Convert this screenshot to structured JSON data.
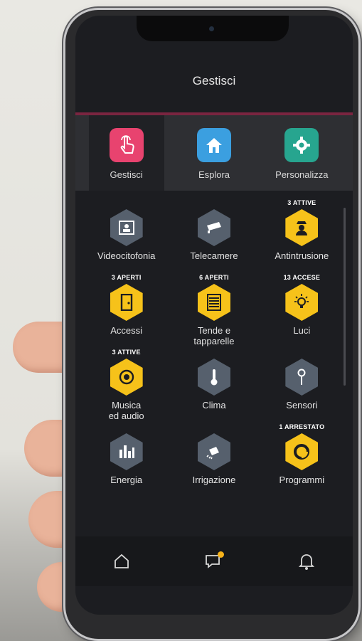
{
  "header": {
    "title": "Gestisci"
  },
  "tabs": [
    {
      "label": "Gestisci",
      "icon": "touch-hand-icon",
      "color": "#e8436f",
      "active": true
    },
    {
      "label": "Esplora",
      "icon": "home-icon",
      "color": "#3b9fe0",
      "active": false
    },
    {
      "label": "Personalizza",
      "icon": "gear-icon",
      "color": "#27a58f",
      "active": false
    }
  ],
  "grid": [
    {
      "label": "Videocitofonia",
      "badge": "",
      "icon": "video-intercom-icon",
      "style": "gray"
    },
    {
      "label": "Telecamere",
      "badge": "",
      "icon": "camera-icon",
      "style": "gray"
    },
    {
      "label": "Antintrusione",
      "badge": "3 ATTIVE",
      "icon": "guard-icon",
      "style": "yellow"
    },
    {
      "label": "Accessi",
      "badge": "3 APERTI",
      "icon": "door-icon",
      "style": "yellow"
    },
    {
      "label": "Tende e\ntapparelle",
      "badge": "6 APERTI",
      "icon": "shutter-icon",
      "style": "yellow"
    },
    {
      "label": "Luci",
      "badge": "13 ACCESE",
      "icon": "bulb-icon",
      "style": "yellow"
    },
    {
      "label": "Musica\ned audio",
      "badge": "3 ATTIVE",
      "icon": "speaker-icon",
      "style": "yellow"
    },
    {
      "label": "Clima",
      "badge": "",
      "icon": "thermometer-icon",
      "style": "gray"
    },
    {
      "label": "Sensori",
      "badge": "",
      "icon": "sensor-icon",
      "style": "gray"
    },
    {
      "label": "Energia",
      "badge": "",
      "icon": "energy-bars-icon",
      "style": "gray"
    },
    {
      "label": "Irrigazione",
      "badge": "",
      "icon": "watering-icon",
      "style": "gray"
    },
    {
      "label": "Programmi",
      "badge": "1 ARRESTATO",
      "icon": "program-icon",
      "style": "yellow"
    }
  ],
  "bottom_nav": [
    {
      "icon": "home-outline-icon"
    },
    {
      "icon": "message-icon",
      "has_notification": true
    },
    {
      "icon": "bell-icon"
    }
  ]
}
